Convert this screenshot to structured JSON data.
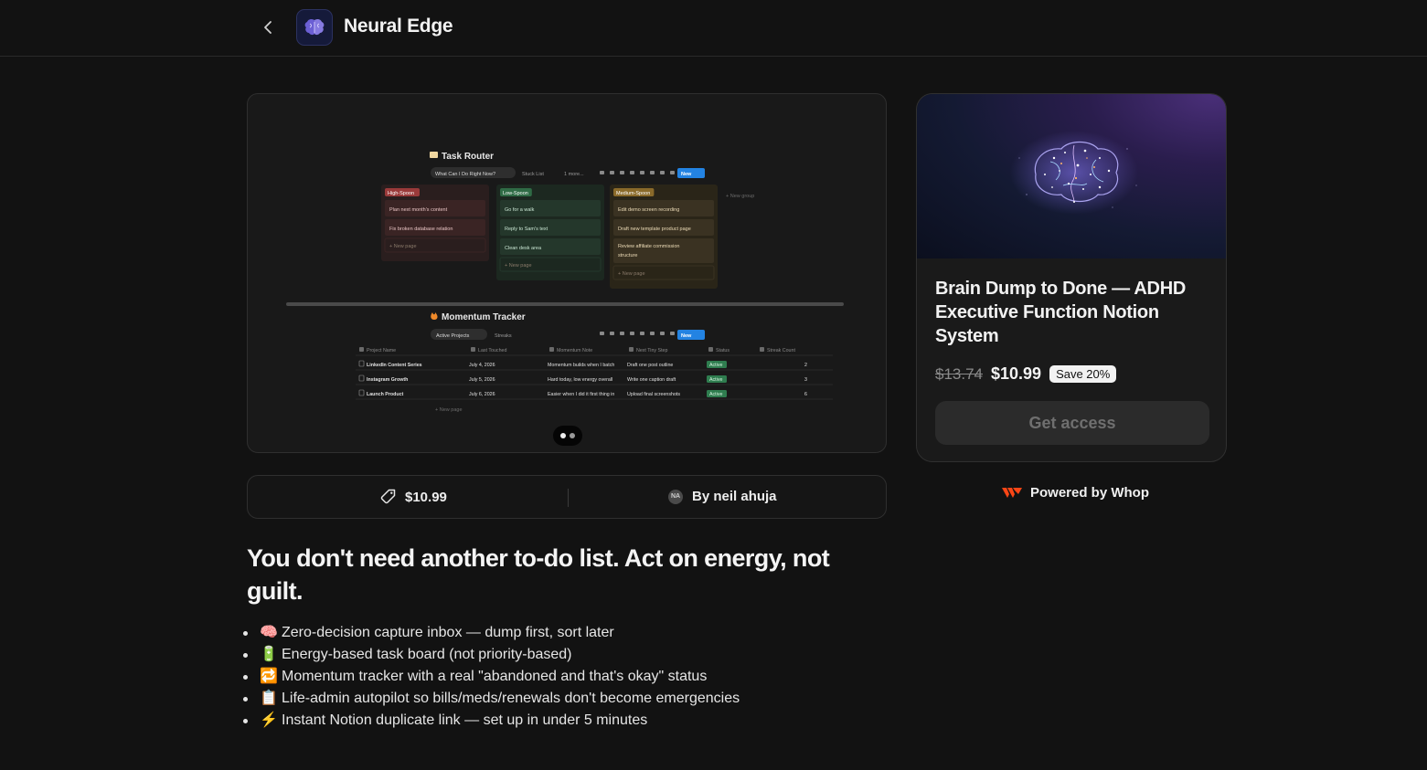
{
  "header": {
    "back_icon": "chevron-left-icon",
    "logo_icon": "brain-icon",
    "brand_name": "Neural Edge"
  },
  "gallery": {
    "slide_count": 2,
    "active_slide": 1,
    "screenshot": {
      "task_router": {
        "title": "Task Router",
        "views": [
          "What Can I Do Right Now?",
          "Stuck List",
          "1 more..."
        ],
        "new_label": "New",
        "new_group_label": "+ New group",
        "new_page_label": "+ New page",
        "columns": [
          {
            "label": "High-Spoon",
            "color": "#9a3a3a",
            "cards": [
              "Plan next month's content",
              "Fix broken database relation"
            ]
          },
          {
            "label": "Low-Spoon",
            "color": "#2f6b45",
            "cards": [
              "Go for a walk",
              "Reply to Sam's text",
              "Clean desk area"
            ]
          },
          {
            "label": "Medium-Spoon",
            "color": "#8a6a2a",
            "cards": [
              "Edit demo screen recording",
              "Draft new template product page",
              "Review affiliate commission structure"
            ]
          }
        ]
      },
      "momentum_tracker": {
        "title": "Momentum Tracker",
        "tabs": [
          "Active Projects",
          "Streaks"
        ],
        "new_label": "New",
        "new_page_label": "+ New page",
        "columns": [
          "Project Name",
          "Last Touched",
          "Momentum Note",
          "Next Tiny Step",
          "Status",
          "Streak Count"
        ],
        "rows": [
          {
            "name": "LinkedIn Content Series",
            "date": "July 4, 2026",
            "note": "Momentum builds when I batch",
            "step": "Draft one post outline",
            "status": "Active",
            "streak": "2"
          },
          {
            "name": "Instagram Growth",
            "date": "July 5, 2026",
            "note": "Hard today, low energy overall",
            "step": "Write one caption draft",
            "status": "Active",
            "streak": "3"
          },
          {
            "name": "Launch Product",
            "date": "July 6, 2026",
            "note": "Easier when I did it first thing in",
            "step": "Upload final screenshots",
            "status": "Active",
            "streak": "6"
          }
        ]
      }
    }
  },
  "info_bar": {
    "price_icon": "price-tag-icon",
    "price": "$10.99",
    "author_initials": "NA",
    "author": "By neil ahuja"
  },
  "description": {
    "headline": "You don't need another to-do list. Act on energy, not guilt.",
    "features": [
      {
        "emoji": "🧠",
        "text": "Zero-decision capture inbox — dump first, sort later"
      },
      {
        "emoji": "🔋",
        "text": "Energy-based task board (not priority-based)"
      },
      {
        "emoji": "🔁",
        "text": "Momentum tracker with a real \"abandoned and that's okay\" status"
      },
      {
        "emoji": "📋",
        "text": "Life-admin autopilot so bills/meds/renewals don't become emergencies"
      },
      {
        "emoji": "⚡",
        "text": "Instant Notion duplicate link — set up in under 5 minutes"
      }
    ]
  },
  "product_card": {
    "hero_image": "glowing-brain-illustration",
    "title": "Brain Dump to Done — ADHD Executive Function Notion System",
    "original_price": "$13.74",
    "price": "$10.99",
    "discount_badge": "Save 20%",
    "cta_label": "Get access"
  },
  "footer": {
    "powered_by": "Powered by Whop",
    "logo_icon": "whop-logo-icon"
  },
  "colors": {
    "background": "#121212",
    "surface": "#1a1a1a",
    "border": "#2f2f2f",
    "notion_blue": "#2383e2",
    "status_green": "#2f7d4f",
    "whop_orange": "#fa4616"
  }
}
